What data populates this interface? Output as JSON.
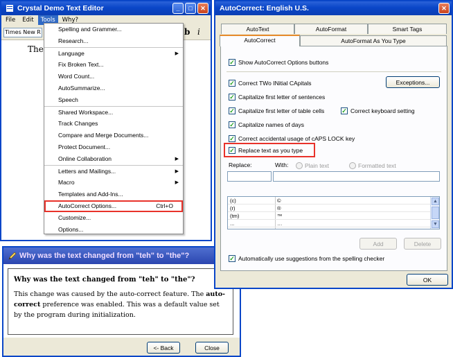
{
  "editor": {
    "title": "Crystal Demo Text Editor",
    "menu": [
      "File",
      "Edit",
      "Tools",
      "Why?"
    ],
    "active_menu": "Tools",
    "font_name": "Times New R",
    "bold_label": "b",
    "italic_label": "i",
    "document_text": "The c"
  },
  "tools_menu": {
    "items": [
      {
        "label": "Spelling and Grammer...",
        "sep": false
      },
      {
        "label": "Research...",
        "sep": false
      },
      {
        "label": "Language",
        "submenu": true,
        "sep": true
      },
      {
        "label": "Fix Broken Text...",
        "sep": false
      },
      {
        "label": "Word Count...",
        "sep": false
      },
      {
        "label": "AutoSummarize...",
        "sep": false
      },
      {
        "label": "Speech",
        "sep": false
      },
      {
        "label": "Shared Workspace...",
        "sep": true
      },
      {
        "label": "Track Changes",
        "sep": false
      },
      {
        "label": "Compare and Merge Documents...",
        "sep": false
      },
      {
        "label": "Protect Document...",
        "sep": false
      },
      {
        "label": "Online Collaboration",
        "submenu": true,
        "sep": false
      },
      {
        "label": "Letters and Mailings...",
        "submenu": true,
        "sep": true
      },
      {
        "label": "Macro",
        "submenu": true,
        "sep": false
      },
      {
        "label": "Templates and Add-Ins...",
        "sep": false
      },
      {
        "label": "AutoCorrect Options...",
        "shortcut": "Ctrl+O",
        "sep": false
      },
      {
        "label": "Customize...",
        "sep": false
      },
      {
        "label": "Options...",
        "sep": false
      }
    ]
  },
  "why_dialog": {
    "title": "Why was the text changed from \"teh\" to \"the\"?",
    "heading": "Why was the text changed from \"teh\" to \"the\"?",
    "body_before": "This change was caused by the auto-correct feature. The ",
    "body_bold": "auto-correct",
    "body_after": " preference was enabled. This was a default value set by the program during initialization.",
    "back_label": "<- Back",
    "close_label": "Close"
  },
  "autocorrect": {
    "title": "AutoCorrect: English U.S.",
    "tabs_row1": [
      "AutoText",
      "AutoFormat",
      "Smart Tags"
    ],
    "tabs_row2": [
      "AutoCorrect",
      "AutoFormat As You Type"
    ],
    "show_buttons": "Show AutoCorrect Options buttons",
    "correct_two_initial": "Correct TWo INitial CApitals",
    "exceptions_label": "Exceptions...",
    "capitalize_sentences": "Capitalize first letter of sentences",
    "capitalize_table_cells": "Capitalize first letter of table cells",
    "correct_keyboard": "Correct keyboard setting",
    "capitalize_days": "Capitalize names of days",
    "caps_lock": "Correct accidental usage of cAPS LOCK key",
    "replace_as_type": "Replace text as you type",
    "replace_label": "Replace:",
    "with_label": "With:",
    "plain_text": "Plain text",
    "formatted_text": "Formatted text",
    "entries": [
      {
        "from": "(c)",
        "to": "©"
      },
      {
        "from": "(r)",
        "to": "®"
      },
      {
        "from": "(tm)",
        "to": "™"
      },
      {
        "from": "...",
        "to": "…"
      }
    ],
    "add_label": "Add",
    "delete_label": "Delete",
    "auto_suggestions": "Automatically use suggestions from the spelling checker",
    "ok_label": "OK"
  },
  "colors": {
    "xp_title": "#0a46c8",
    "highlight_red": "#e8322a",
    "check_green": "#21a121"
  }
}
